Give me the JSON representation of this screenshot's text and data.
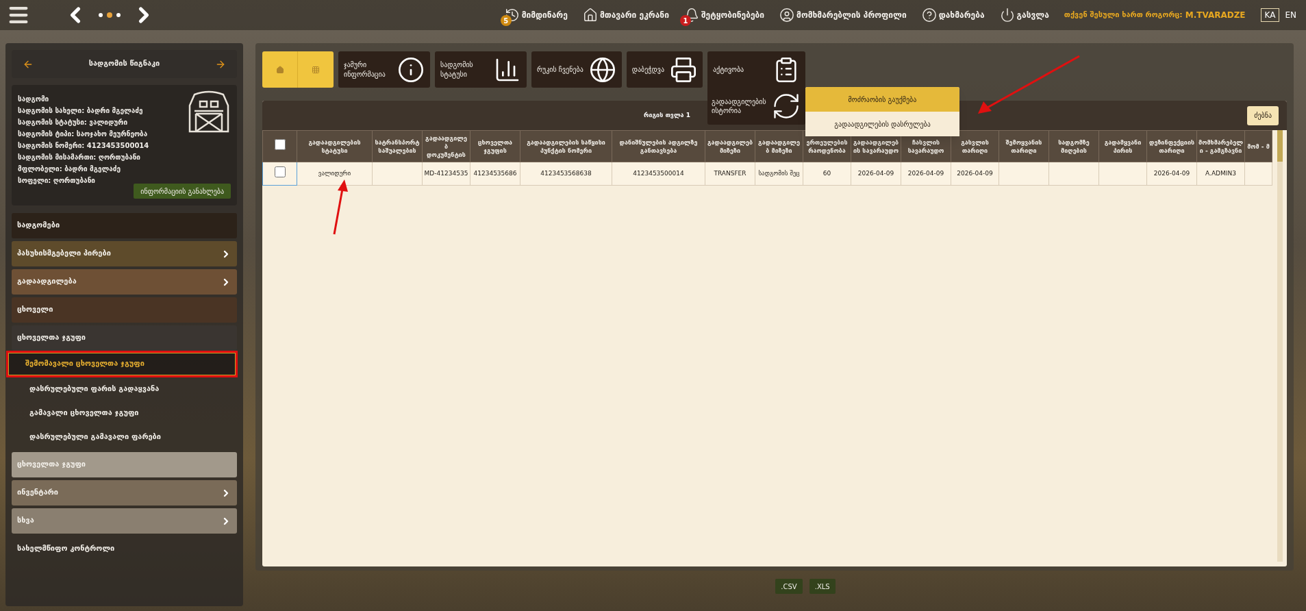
{
  "top_bar": {
    "nav_items": [
      {
        "kind": "history",
        "label": "მიმდინარე",
        "badge": "5"
      },
      {
        "kind": "home",
        "label": "მთავარი ეკრანი"
      },
      {
        "kind": "bell",
        "label": "შეტყობინებები",
        "badge": "1"
      },
      {
        "kind": "user",
        "label": "მომხმარებლის პროფილი"
      },
      {
        "kind": "help",
        "label": "დახმარება"
      },
      {
        "kind": "power",
        "label": "გასვლა"
      }
    ],
    "user_label": "თქვენ შესული ხართ როგორც:",
    "username": "M.TVARADZE",
    "languages": [
      {
        "label": "KA",
        "selected": true
      },
      {
        "label": "EN",
        "selected": false
      }
    ]
  },
  "sidebar": {
    "title": "სადგომის წიგნაკი",
    "info_lines": [
      "სადგომი",
      "სადგომის სახელი: ბადრი მგელაძე",
      "სადგომის სტატუსი: ვალიდური",
      "სადგომის ტიპი: საოჯახო მეურნეობა",
      "სადგომის ნომერი: 4123453500014",
      "სადგომის მისამართი: ღორთუბანი",
      "მფლობელი: ბადრი მგელაძე",
      "სოფელი: ღორთუბანი"
    ],
    "update_button": "ინფორმაციის განახლება",
    "menu": [
      {
        "label": "სადგომები",
        "color": "#2c2219",
        "expandable": false
      },
      {
        "label": "პასუხისმგებელი პირები",
        "color": "#5e4b2b",
        "expandable": true
      },
      {
        "label": "გადაადგილება",
        "color": "#6e5035",
        "expandable": true
      },
      {
        "label": "ცხოველი",
        "color": "#4a3424",
        "expandable": false
      },
      {
        "label": "ცხოველთა ჯგუფი",
        "color": "#3a3531",
        "expandable": false,
        "expanded": true,
        "children": [
          {
            "label": "შემომავალი ცხოველთა ჯგუფი",
            "selected": true
          },
          {
            "label": "დასრულებული ფარის გადაყვანა",
            "selected": false
          },
          {
            "label": "გამავალი ცხოველთა ჯგუფი",
            "selected": false
          },
          {
            "label": "დასრულებული გამავალი ფარები",
            "selected": false
          }
        ]
      },
      {
        "label": "ცხოველთა ჯგუფი",
        "color": "#a2998b",
        "expandable": false
      },
      {
        "label": "ინვენტარი",
        "color": "#7a6b58",
        "expandable": true
      },
      {
        "label": "სხვა",
        "color": "#8a7f70",
        "expandable": true
      },
      {
        "label": "სახელმწიფო კონტროლი",
        "expandable": false
      }
    ]
  },
  "toolbar": {
    "tiles": [
      {
        "kind": "info",
        "label": "ჯამური ინფორმაცია"
      },
      {
        "kind": "chart",
        "label": "სადგომის სტატუსი"
      },
      {
        "kind": "globe",
        "label": "რუკის ჩვენება"
      },
      {
        "kind": "printer",
        "label": "დაბეჭდვა"
      }
    ],
    "activity": {
      "label": "აქტივობა",
      "expanded": true,
      "history_tile": "გადაადგილების ისტორია",
      "menu": [
        {
          "label": "მოძრაობის გაუქმება",
          "selected": true
        },
        {
          "label": "გადაადგილების დასრულება",
          "selected": false
        }
      ]
    }
  },
  "table": {
    "row_count": "რიგის თვლა 1",
    "search_button": "ძებნა",
    "select_all_checked": false,
    "columns": [
      "გადაადგილების სტატუსი",
      "სატრანსპორტ საშუალების",
      "გადაადგილებ დოკუმენტის",
      "ცხოველთა ჯგუფის",
      "გადაადგილების საწყისი პუნქტის ნომერი",
      "დანიშნულების ადგილზე განთავსება",
      "გადაადგილებ მიზეზი",
      "გადაადგილებ მიზეზი",
      "ერთეულების რაოდენობა",
      "გადაადგილების სავარაუდო",
      "ჩასვლის სავარაუდო",
      "გასვლის თარიღი",
      "შემოყვანის თარიღი",
      "სადგომზე მიღების",
      "გადამყვანი პირის",
      "დეზინფექციის თარიღი",
      "მომხმარებელი - გამგზავნი",
      "მომ - მ"
    ],
    "rows": [
      {
        "checked": false,
        "cells": [
          "ვალიდური",
          "",
          "MD-41234535",
          "41234535686",
          "4123453568638",
          "4123453500014",
          "TRANSFER",
          "სადგომის შეც",
          "60",
          "2026-04-09",
          "2026-04-09",
          "2026-04-09",
          "",
          "",
          "",
          "2026-04-09",
          "A.ADMIN3",
          ""
        ]
      }
    ]
  },
  "export_buttons": [
    ".CSV",
    ".XLS"
  ]
}
